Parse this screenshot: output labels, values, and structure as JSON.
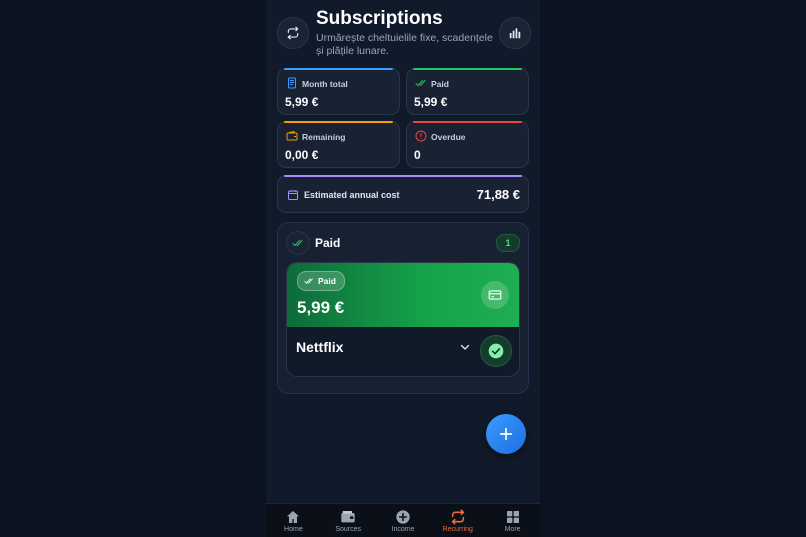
{
  "header": {
    "title": "Subscriptions",
    "subtitle": "Urmărește cheltuielile fixe, scadențele și plățile lunare."
  },
  "stats": {
    "month_total": {
      "label": "Month total",
      "value": "5,99 €",
      "color": "#3b9bff"
    },
    "paid": {
      "label": "Paid",
      "value": "5,99 €",
      "color": "#22c55e"
    },
    "remaining": {
      "label": "Remaining",
      "value": "0,00 €",
      "color": "#f59e0b"
    },
    "overdue": {
      "label": "Overdue",
      "value": "0",
      "color": "#ef4444"
    }
  },
  "annual": {
    "label": "Estimated annual cost",
    "value": "71,88 €",
    "color": "#a78bfa"
  },
  "group": {
    "title": "Paid",
    "count": "1",
    "item": {
      "status": "Paid",
      "amount": "5,99 €",
      "name": "Nettflix"
    }
  },
  "nav": {
    "items": [
      {
        "label": "Home",
        "icon": "home-icon"
      },
      {
        "label": "Sources",
        "icon": "wallet-icon"
      },
      {
        "label": "Income",
        "icon": "plus-circle-icon"
      },
      {
        "label": "Recurring",
        "icon": "repeat-icon"
      },
      {
        "label": "More",
        "icon": "grid-icon"
      }
    ],
    "active": "Recurring",
    "active_color": "#ef6a3a"
  }
}
